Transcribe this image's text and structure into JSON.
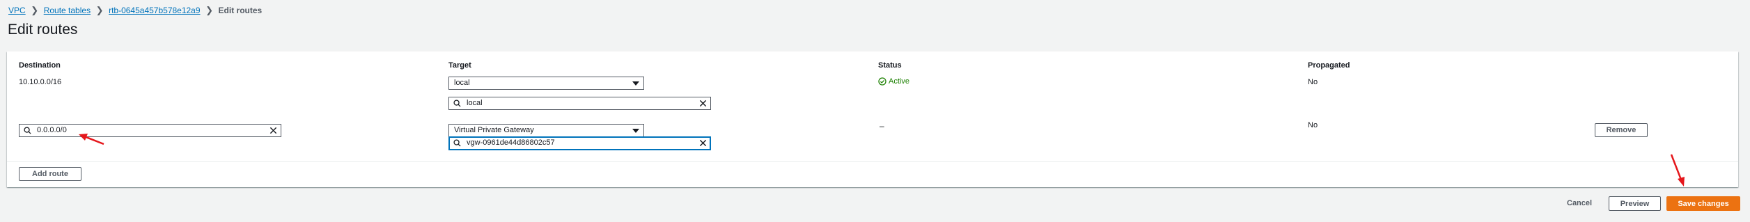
{
  "breadcrumb": {
    "items": [
      {
        "label": "VPC"
      },
      {
        "label": "Route tables"
      },
      {
        "label": "rtb-0645a457b578e12a9"
      }
    ],
    "current": "Edit routes"
  },
  "page_title": "Edit routes",
  "table": {
    "columns": {
      "destination": "Destination",
      "target": "Target",
      "status": "Status",
      "propagated": "Propagated"
    },
    "rows": [
      {
        "destination": "10.10.0.0/16",
        "target_type": "local",
        "target_search": "local",
        "status": "Active",
        "propagated": "No"
      },
      {
        "destination_value": "0.0.0.0/0",
        "target_type": "Virtual Private Gateway",
        "target_search": "vgw-0961de44d86802c57",
        "status": "–",
        "propagated": "No",
        "remove_label": "Remove"
      }
    ]
  },
  "add_route_label": "Add route",
  "footer": {
    "cancel_label": "Cancel",
    "preview_label": "Preview",
    "save_label": "Save changes"
  },
  "colors": {
    "link": "#0073bb",
    "success": "#1d8102",
    "primary": "#ec7211",
    "annotation": "#e5171c"
  },
  "icons": [
    "chevron-right-icon",
    "search-icon",
    "clear-icon",
    "caret-down-icon",
    "check-circle-icon",
    "annotation-arrow-icon"
  ]
}
